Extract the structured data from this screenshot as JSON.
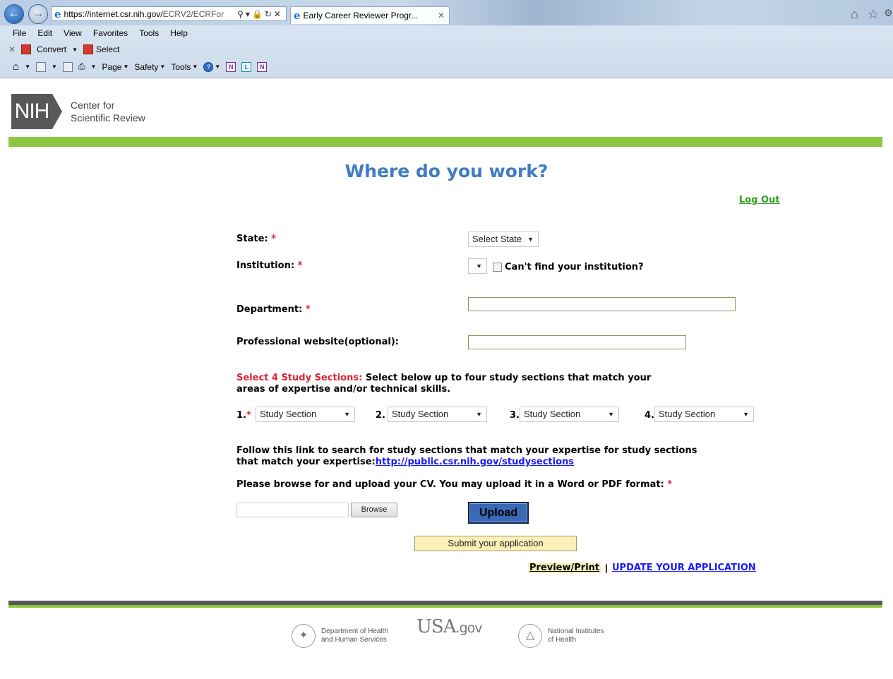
{
  "browser": {
    "url_main": "https://internet.csr.nih.gov/",
    "url_rest": "ECRV2/ECRFor",
    "tab_title": "Early Career Reviewer Progr...",
    "menu": [
      "File",
      "Edit",
      "View",
      "Favorites",
      "Tools",
      "Help"
    ],
    "cmd": {
      "convert": "Convert",
      "select": "Select"
    },
    "fav": {
      "page": "Page",
      "safety": "Safety",
      "tools": "Tools"
    }
  },
  "header": {
    "logo_text": "NIH",
    "org_line1": "Center for",
    "org_line2": "Scientific Review",
    "accent": "#8dc63f"
  },
  "page": {
    "title": "Where do you work?",
    "logout": "Log Out"
  },
  "form": {
    "state_label": "State:",
    "state_value": "Select State",
    "institution_label": "Institution:",
    "cant_find": "Can't find your institution?",
    "department_label": "Department:",
    "website_label": "Professional website(optional):",
    "required_mark": "*",
    "study_red": "Select 4 Study Sections:",
    "study_text": " Select below up to four study sections that match your",
    "study_text2": "areas of expertise and/or technical skills.",
    "study_sections": [
      {
        "num": "1.",
        "value": "Study Section"
      },
      {
        "num": "2.",
        "value": "Study Section"
      },
      {
        "num": "3.",
        "value": "Study Section"
      },
      {
        "num": "4.",
        "value": "Study Section"
      }
    ],
    "follow_text1": "Follow this link to search for study sections that match your expertise for study sections",
    "follow_text2": "that match your expertise:",
    "follow_link": "http://public.csr.nih.gov/studysections",
    "cv_text": "Please browse for and upload your CV. You may upload it in a Word or PDF format:",
    "browse": "Browse",
    "upload": "Upload",
    "submit": "Submit your application",
    "preview": "Preview/Print",
    "separator": "|",
    "update": "UPDATE YOUR APPLICATION"
  },
  "footer": {
    "hhs_line1": "Department of Health",
    "hhs_line2": "and Human Services",
    "usa": "USA",
    "gov": ".gov",
    "nih_line1": "National Institutes",
    "nih_line2": "of Health"
  }
}
